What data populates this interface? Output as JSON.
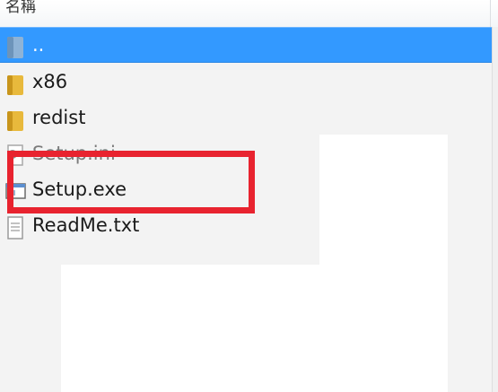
{
  "header": {
    "column_title": "名稱"
  },
  "files": [
    {
      "name": "..",
      "icon": "folder-up-icon",
      "selected": true
    },
    {
      "name": "x86",
      "icon": "folder-icon"
    },
    {
      "name": "redist",
      "icon": "folder-icon"
    },
    {
      "name": "Setup.ini",
      "icon": "settings-file-icon"
    },
    {
      "name": "Setup.exe",
      "icon": "exe-file-icon"
    },
    {
      "name": "ReadMe.txt",
      "icon": "text-file-icon"
    }
  ],
  "colors": {
    "selection": "#3399ff",
    "highlight_box": "#e8232f",
    "folder": "#e8b93c"
  }
}
